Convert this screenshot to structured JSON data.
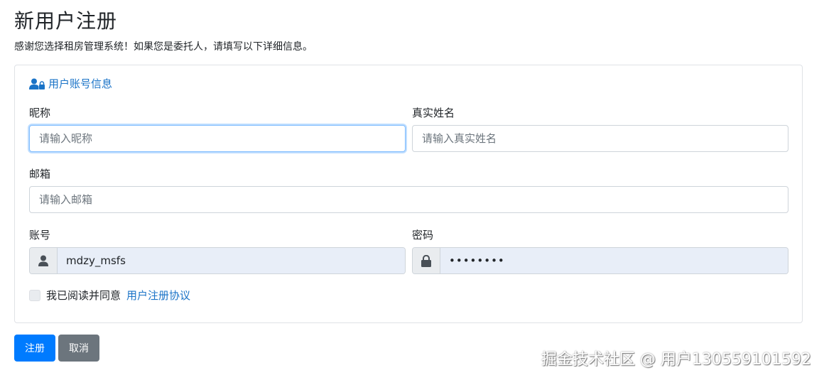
{
  "page": {
    "title": "新用户注册",
    "subtitle": "感谢您选择租房管理系统！如果您是委托人，请填写以下详细信息。"
  },
  "card": {
    "section_title": "用户账号信息",
    "section_icon": "user-lock-icon"
  },
  "form": {
    "nickname": {
      "label": "昵称",
      "placeholder": "请输入昵称",
      "value": ""
    },
    "realname": {
      "label": "真实姓名",
      "placeholder": "请输入真实姓名",
      "value": ""
    },
    "email": {
      "label": "邮箱",
      "placeholder": "请输入邮箱",
      "value": ""
    },
    "account": {
      "label": "账号",
      "value": "mdzy_msfs",
      "icon": "user-icon"
    },
    "password": {
      "label": "密码",
      "value": "••••••••",
      "icon": "lock-icon"
    },
    "agree": {
      "text": "我已阅读并同意",
      "link": "用户注册协议",
      "checked": false
    }
  },
  "buttons": {
    "submit": "注册",
    "cancel": "取消"
  },
  "watermark": "掘金技术社区 @ 用户130559101592",
  "colors": {
    "primary": "#007bff",
    "secondary": "#6c757d",
    "link": "#1a73c7",
    "autofill_bg": "#e8eef8"
  }
}
